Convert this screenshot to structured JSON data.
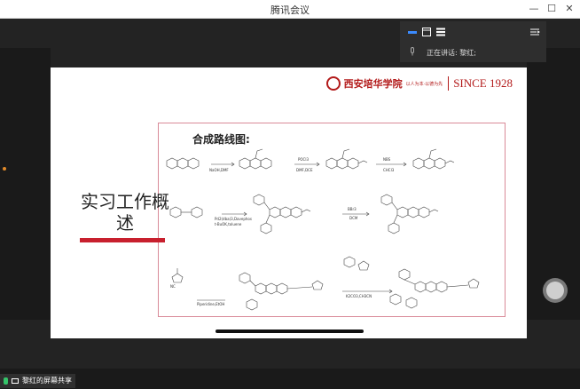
{
  "window": {
    "title": "腾讯会议",
    "minimize": "—",
    "maximize": "☐",
    "close": "✕"
  },
  "slide": {
    "school_name": "西安培华学院",
    "school_motto": "以人为本·以德为先",
    "since": "SINCE 1928",
    "route_title": "合成路线图:",
    "heading": "实习工作概述",
    "reagents": [
      "NaOH,DMF",
      "POCl3",
      "DMF,DCE",
      "NBS",
      "CHCl3",
      "Pd2(dba)3,Davephos",
      "t-BuOK,toluene",
      "BBr3",
      "DCM",
      "NC",
      "Piperidine,EtOH",
      "K2CO3,CH3CN"
    ]
  },
  "panel": {
    "speaking": "正在讲话:  黎红;"
  },
  "footer": {
    "share_label": "黎红的屏幕共享"
  },
  "colors": {
    "accent_red": "#c8202e",
    "frame_pink": "#d98a98",
    "mic_green": "#35c46a"
  }
}
